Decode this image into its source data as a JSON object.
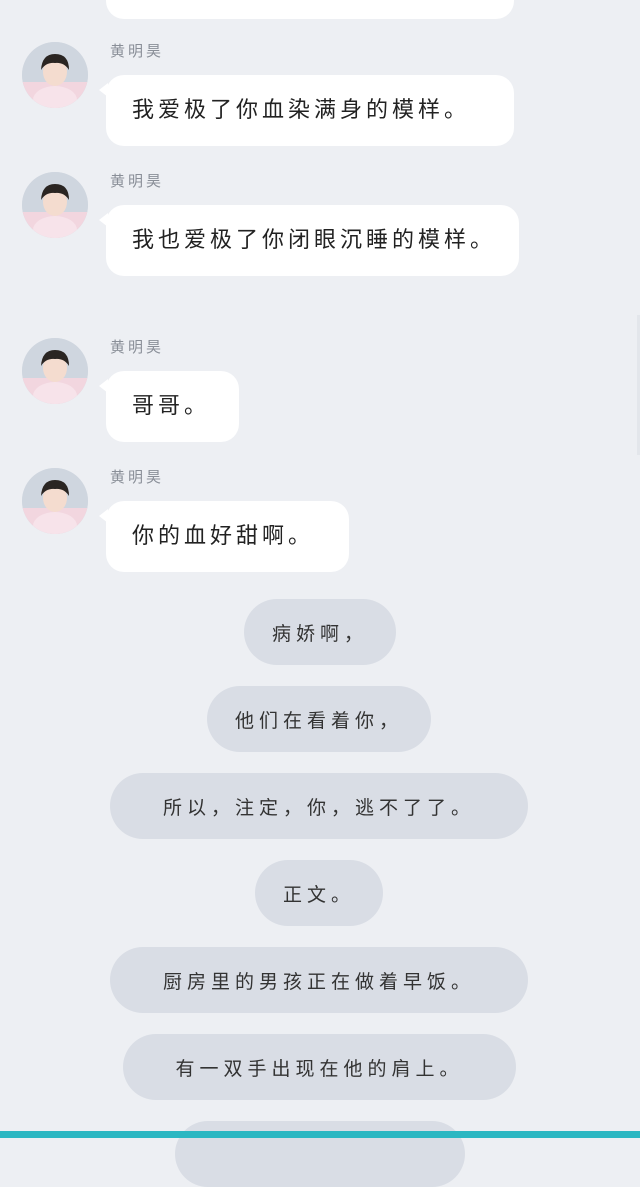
{
  "messages": [
    {
      "sender": "黄明昊",
      "text": "我爱极了你血染满身的模样。"
    },
    {
      "sender": "黄明昊",
      "text": "我也爱极了你闭眼沉睡的模样。"
    },
    {
      "sender": "黄明昊",
      "text": "哥哥。"
    },
    {
      "sender": "黄明昊",
      "text": "你的血好甜啊。"
    }
  ],
  "narration": [
    "病娇啊，",
    "他们在看着你，",
    "所以，注定，你，逃不了了。",
    "正文。",
    "厨房里的男孩正在做着早饭。",
    "有一双手出现在他的肩上。"
  ],
  "colors": {
    "background": "#edeff3",
    "bubble": "#ffffff",
    "pill": "#d9dde5",
    "accent_bar": "#2bb7c2"
  }
}
